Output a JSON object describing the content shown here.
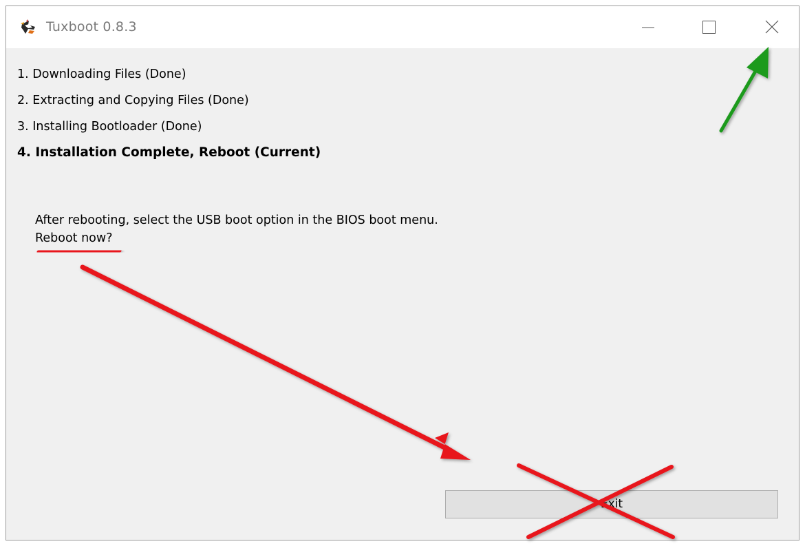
{
  "window": {
    "title": "Tuxboot 0.8.3",
    "app_icon": "tuxboot-penguin-icon",
    "controls": {
      "minimize_icon": "minimize-icon",
      "maximize_icon": "maximize-icon",
      "close_icon": "close-icon"
    }
  },
  "steps": [
    {
      "label": "1. Downloading Files (Done)",
      "state": "done"
    },
    {
      "label": "2. Extracting and Copying Files (Done)",
      "state": "done"
    },
    {
      "label": "3. Installing Bootloader (Done)",
      "state": "done"
    },
    {
      "label": "4. Installation Complete, Reboot (Current)",
      "state": "current"
    }
  ],
  "message": {
    "line1": "After rebooting, select the USB boot option in the BIOS boot menu.",
    "line2": "Reboot now?"
  },
  "buttons": {
    "exit_label": "Exit"
  },
  "annotations": {
    "red_color": "#e8141c",
    "green_color": "#1e9a1e",
    "items": [
      "green-arrow-to-close",
      "red-underline-reboot-now",
      "red-arrow-to-exit",
      "red-cross-over-exit"
    ]
  }
}
